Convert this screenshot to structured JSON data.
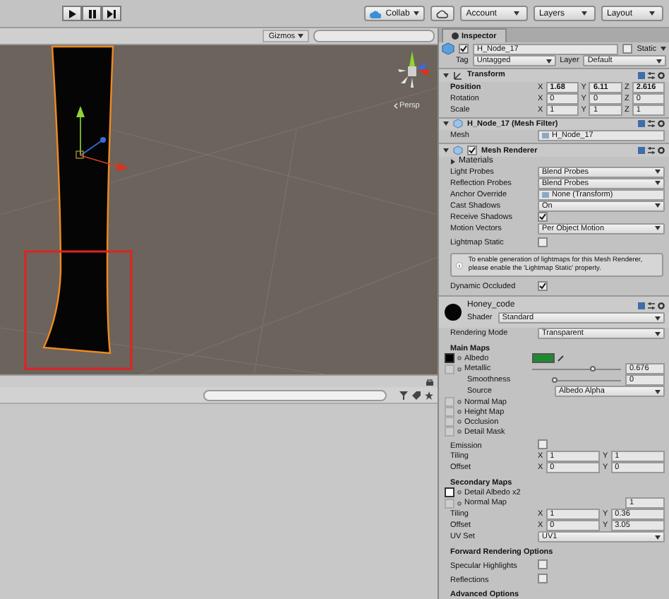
{
  "toolbar": {
    "play_buttons": [
      {
        "kind": "play"
      },
      {
        "kind": "pause"
      },
      {
        "kind": "step"
      }
    ],
    "buttons": [
      {
        "kind": "collab",
        "label": "Collab"
      },
      {
        "kind": "cloud"
      },
      {
        "kind": "dropdown",
        "label": "Account"
      },
      {
        "kind": "dropdown",
        "label": "Layers"
      },
      {
        "kind": "dropdown",
        "label": "Layout"
      }
    ]
  },
  "scene": {
    "gizmos_label": "Gizmos",
    "view_label": "Persp"
  },
  "inspector": {
    "tab": "Inspector",
    "object": {
      "name": "H_Node_17",
      "active": true,
      "static_label": "Static",
      "static": false,
      "tag_label": "Tag",
      "tag": "Untagged",
      "layer_label": "Layer",
      "layer": "Default"
    },
    "rows": [
      {
        "kind": "component",
        "title": "Transform"
      },
      {
        "kind": "vector",
        "label": "Position",
        "modified": true,
        "values": [
          {
            "axis": "X",
            "value": "1.68"
          },
          {
            "axis": "Y",
            "value": "6.11"
          },
          {
            "axis": "Z",
            "value": "2.616"
          }
        ]
      },
      {
        "kind": "vector",
        "label": "Rotation",
        "modified": false,
        "values": [
          {
            "axis": "X",
            "value": "0"
          },
          {
            "axis": "Y",
            "value": "0"
          },
          {
            "axis": "Z",
            "value": "0"
          }
        ]
      },
      {
        "kind": "vector",
        "label": "Scale",
        "modified": false,
        "values": [
          {
            "axis": "X",
            "value": "1"
          },
          {
            "axis": "Y",
            "value": "1"
          },
          {
            "axis": "Z",
            "value": "1"
          }
        ]
      },
      {
        "kind": "component",
        "title": "H_Node_17 (Mesh Filter)"
      },
      {
        "kind": "object",
        "label": "Mesh",
        "value": "H_Node_17"
      },
      {
        "kind": "component",
        "title": "Mesh Renderer",
        "enabled": true
      },
      {
        "kind": "foldout",
        "label": "Materials",
        "expanded": false
      },
      {
        "kind": "dropdown",
        "label": "Light Probes",
        "value": "Blend Probes"
      },
      {
        "kind": "dropdown",
        "label": "Reflection Probes",
        "value": "Blend Probes"
      },
      {
        "kind": "object",
        "label": "Anchor Override",
        "value": "None (Transform)"
      },
      {
        "kind": "dropdown",
        "label": "Cast Shadows",
        "value": "On"
      },
      {
        "kind": "check",
        "label": "Receive Shadows",
        "checked": true
      },
      {
        "kind": "dropdown",
        "label": "Motion Vectors",
        "value": "Per Object Motion"
      },
      {
        "kind": "check",
        "label": "Lightmap Static",
        "checked": false
      },
      {
        "kind": "help",
        "text": "To enable generation of lightmaps for this Mesh Renderer, please enable the 'Lightmap Static' property."
      },
      {
        "kind": "check",
        "label": "Dynamic Occluded",
        "checked": true
      },
      {
        "kind": "material",
        "name": "Honey_code",
        "shader_label": "Shader",
        "shader": "Standard",
        "color": "#050505"
      },
      {
        "kind": "dropdown",
        "label": "Rendering Mode",
        "value": "Transparent"
      },
      {
        "kind": "section",
        "label": "Main Maps"
      },
      {
        "kind": "map",
        "label": "Albedo",
        "texture": true,
        "color": "#1e8a2e"
      },
      {
        "kind": "slider",
        "label": "Metallic",
        "level": 0.676,
        "reading": "0.676",
        "children": [
          {
            "kind": "slider",
            "label": "Smoothness",
            "level": 0,
            "reading": "0"
          },
          {
            "kind": "dropdown",
            "label": "Source",
            "value": "Albedo Alpha"
          }
        ]
      },
      {
        "kind": "map",
        "label": "Normal Map",
        "texture": false
      },
      {
        "kind": "map",
        "label": "Height Map",
        "texture": false
      },
      {
        "kind": "map",
        "label": "Occlusion",
        "texture": false
      },
      {
        "kind": "map",
        "label": "Detail Mask",
        "texture": false
      },
      {
        "kind": "check",
        "label": "Emission",
        "checked": false
      },
      {
        "kind": "vector",
        "label": "Tiling",
        "modified": false,
        "values": [
          {
            "axis": "X",
            "value": "1"
          },
          {
            "axis": "Y",
            "value": "1"
          }
        ]
      },
      {
        "kind": "vector",
        "label": "Offset",
        "modified": false,
        "values": [
          {
            "axis": "X",
            "value": "0"
          },
          {
            "axis": "Y",
            "value": "0"
          }
        ]
      },
      {
        "kind": "section",
        "label": "Secondary Maps"
      },
      {
        "kind": "map",
        "label": "Detail Albedo x2",
        "texture": true
      },
      {
        "kind": "map",
        "label": "Normal Map",
        "texture": false,
        "reading": "1"
      },
      {
        "kind": "vector",
        "label": "Tiling",
        "modified": false,
        "values": [
          {
            "axis": "X",
            "value": "1"
          },
          {
            "axis": "Y",
            "value": "0.36"
          }
        ]
      },
      {
        "kind": "vector",
        "label": "Offset",
        "modified": false,
        "values": [
          {
            "axis": "X",
            "value": "0"
          },
          {
            "axis": "Y",
            "value": "3.05"
          }
        ]
      },
      {
        "kind": "dropdown",
        "label": "UV Set",
        "value": "UV1"
      },
      {
        "kind": "section",
        "label": "Forward Rendering Options"
      },
      {
        "kind": "check",
        "label": "Specular Highlights",
        "checked": false
      },
      {
        "kind": "check",
        "label": "Reflections",
        "checked": false
      },
      {
        "kind": "section",
        "label": "Advanced Options"
      }
    ]
  }
}
